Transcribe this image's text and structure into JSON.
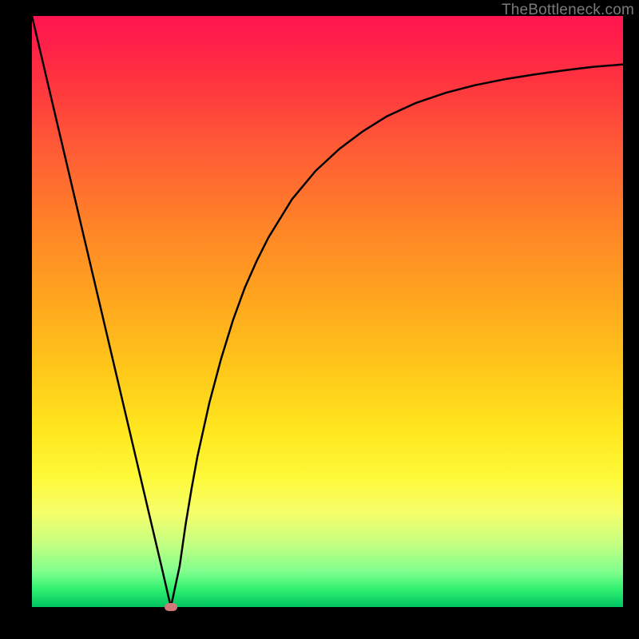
{
  "attribution": "TheBottleneck.com",
  "colors": {
    "frame_bg": "#000000",
    "curve": "#000000",
    "marker": "#d37878",
    "gradient_top": "#ff1450",
    "gradient_bottom": "#00c462"
  },
  "chart_data": {
    "type": "line",
    "title": "",
    "xlabel": "",
    "ylabel": "",
    "xlim": [
      0,
      100
    ],
    "ylim": [
      0,
      100
    ],
    "series": [
      {
        "name": "bottleneck-curve",
        "x": [
          0,
          2,
          4,
          6,
          8,
          10,
          12,
          14,
          16,
          18,
          20,
          22,
          23.5,
          25,
          26,
          27,
          28,
          30,
          32,
          34,
          36,
          38,
          40,
          44,
          48,
          52,
          56,
          60,
          65,
          70,
          75,
          80,
          85,
          90,
          95,
          100
        ],
        "y": [
          100,
          91.5,
          83,
          74.5,
          66,
          57.5,
          49,
          40.5,
          32,
          23.5,
          15,
          6.5,
          0,
          7,
          14,
          20,
          25.5,
          34.5,
          42,
          48.5,
          54,
          58.5,
          62.5,
          69,
          73.8,
          77.5,
          80.5,
          83,
          85.3,
          87,
          88.3,
          89.3,
          90.1,
          90.8,
          91.4,
          91.8
        ]
      }
    ],
    "marker": {
      "x": 23.5,
      "y": 0
    }
  }
}
